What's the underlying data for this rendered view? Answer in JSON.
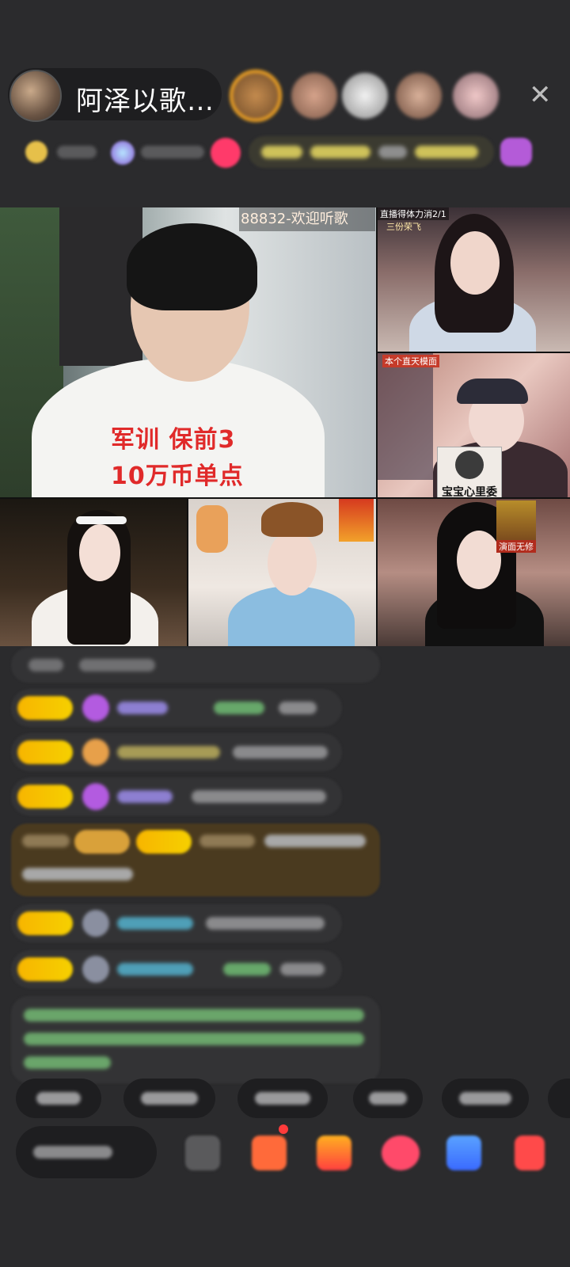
{
  "header": {
    "host_name": "阿泽以歌…",
    "close_label": "✕"
  },
  "stream": {
    "ticker": "88832-欢迎听歌",
    "overlay_line1": "军训 保前3",
    "overlay_line2": "10万币单点",
    "tile2_caption_line1": "直播得体力消2/1",
    "tile2_caption_line2": "三份荣飞",
    "tile3_caption": "本个直天模面",
    "bear_caption": "宝宝心里委屈",
    "tile6_caption": "演面无修"
  },
  "colors": {
    "badge_yellow": "#f7b500",
    "chat_bg": "#333335",
    "page_bg": "#2b2b2d",
    "overlay_red": "#e02a2a"
  }
}
